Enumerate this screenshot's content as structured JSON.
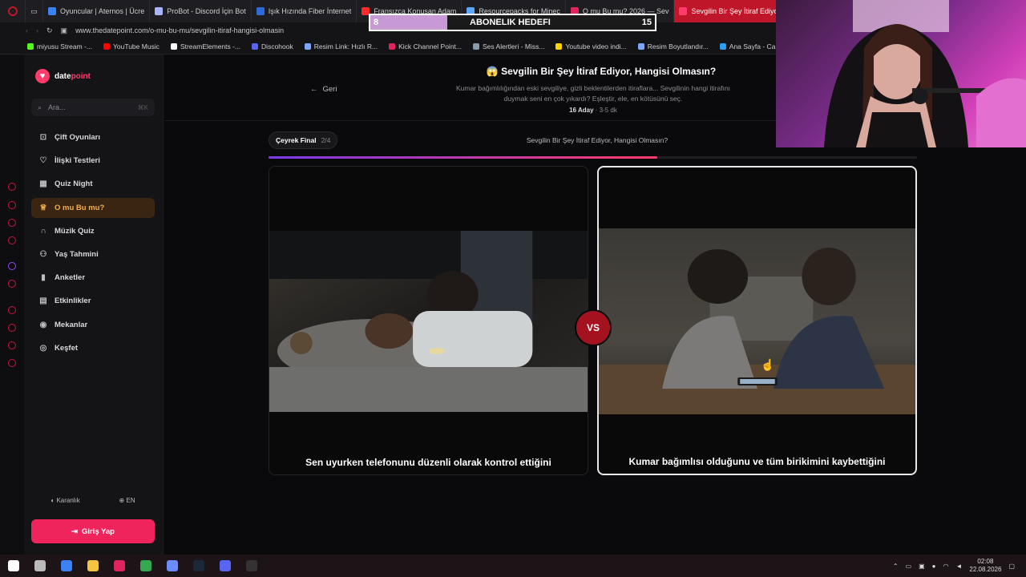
{
  "browser": {
    "tabs": [
      {
        "label": "Oyuncular | Aternos | Ücre",
        "color": "#3b82f6"
      },
      {
        "label": "ProBot - Discord İçin Bot",
        "color": "#a8b4ff"
      },
      {
        "label": "Işık Hızında Fiber İnternet",
        "color": "#2f6bd8"
      },
      {
        "label": "Fransızca Konuşan Adam",
        "color": "#ff2a2a"
      },
      {
        "label": "Resourcepacks for Minec",
        "color": "#59a7ff"
      },
      {
        "label": "O mu Bu mu? 2026 — Sev",
        "color": "#e0245e"
      },
      {
        "label": "Sevgilin Bir Şey İtiraf Ediyo",
        "color": "#ff3b6b"
      }
    ],
    "new_tab": "+",
    "url": "www.thedatepoint.com/o-mu-bu-mu/sevgilin-itiraf-hangisi-olmasin",
    "bookmarks": [
      {
        "label": "miyusu Stream -...",
        "color": "#53fc18"
      },
      {
        "label": "YouTube Music",
        "color": "#ff0000"
      },
      {
        "label": "StreamElements -...",
        "color": "#ffffff"
      },
      {
        "label": "Discohook",
        "color": "#5865f2"
      },
      {
        "label": "Resim Link: Hızlı R...",
        "color": "#7aa7ff"
      },
      {
        "label": "Kick Channel Point...",
        "color": "#e0245e"
      },
      {
        "label": "Ses Alertleri - Miss...",
        "color": "#8899aa"
      },
      {
        "label": "Youtube video indi...",
        "color": "#ffd400"
      },
      {
        "label": "Resim Boyutlandır...",
        "color": "#7aa7ff"
      },
      {
        "label": "Ana Sayfa - Ca",
        "color": "#2a9df4"
      }
    ]
  },
  "goal": {
    "left": "8",
    "label": "ABONELIK HEDEFI",
    "right": "15",
    "progress": 0.27
  },
  "sidebar": {
    "logo_a": "date",
    "logo_b": "point",
    "search_placeholder": "Ara...",
    "search_hint": "⌘K",
    "items": [
      {
        "label": "Çift Oyunları",
        "icon": "gamepad-icon",
        "glyph": "⊡"
      },
      {
        "label": "İlişki Testleri",
        "icon": "heart-icon",
        "glyph": "♡"
      },
      {
        "label": "Quiz Night",
        "icon": "calendar-icon",
        "glyph": "▦"
      },
      {
        "label": "O mu Bu mu?",
        "icon": "trophy-icon",
        "glyph": "♕"
      },
      {
        "label": "Müzik Quiz",
        "icon": "headphones-icon",
        "glyph": "∩"
      },
      {
        "label": "Yaş Tahmini",
        "icon": "users-icon",
        "glyph": "⚇"
      },
      {
        "label": "Anketler",
        "icon": "bar-chart-icon",
        "glyph": "▮"
      },
      {
        "label": "Etkinlikler",
        "icon": "calendar-icon",
        "glyph": "▤"
      },
      {
        "label": "Mekanlar",
        "icon": "map-pin-icon",
        "glyph": "◉"
      },
      {
        "label": "Keşfet",
        "icon": "compass-icon",
        "glyph": "◎"
      }
    ],
    "active_index": 3,
    "theme_label": "Karanlık",
    "lang_label": "EN",
    "login_label": "Giriş Yap"
  },
  "main": {
    "back_label": "Geri",
    "title_emoji": "😱",
    "title": "Sevgilin Bir Şey İtiraf Ediyor, Hangisi Olmasın?",
    "description": "Kumar bağımlılığından eski sevgiliye, gizli beklentilerden itiraflara... Sevgilinin hangi itirafını duymak seni en çok yıkardı? Eşleştir, ele, en kötüsünü seç.",
    "candidates": "16 Aday",
    "duration": "3-5 dk",
    "round_label": "Çeyrek Final",
    "round_count": "2/4",
    "round_title": "Sevgilin Bir Şey İtiraf Ediyor, Hangisi Olmasın?",
    "progress": 0.6,
    "vs": "VS",
    "options": [
      {
        "caption": "Sen uyurken telefonunu düzenli olarak kontrol ettiğini"
      },
      {
        "caption": "Kumar bağımlısı olduğunu ve tüm birikimini kaybettiğini"
      }
    ]
  },
  "taskbar": {
    "apps": [
      {
        "name": "windows-start-icon",
        "color": "#ffffff"
      },
      {
        "name": "task-view-icon",
        "color": "#bbbbbb"
      },
      {
        "name": "file-icon",
        "color": "#3b82f6"
      },
      {
        "name": "folder-icon",
        "color": "#f5c542"
      },
      {
        "name": "opera-icon",
        "color": "#e0245e"
      },
      {
        "name": "chrome-icon",
        "color": "#34a853"
      },
      {
        "name": "app-icon",
        "color": "#6b8cff"
      },
      {
        "name": "steam-icon",
        "color": "#1b2838"
      },
      {
        "name": "discord-icon",
        "color": "#5865f2"
      },
      {
        "name": "obs-icon",
        "color": "#333333"
      }
    ],
    "time": "02:08",
    "date": "22.08.2026"
  }
}
